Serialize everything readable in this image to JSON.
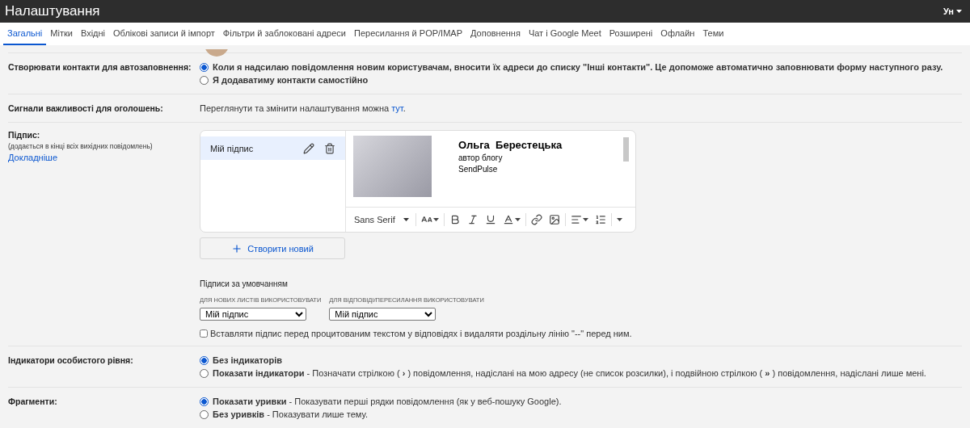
{
  "header": {
    "title": "Налаштування",
    "account": "Ун"
  },
  "tabs": [
    {
      "label": "Загальні",
      "selected": true
    },
    {
      "label": "Мітки",
      "selected": false
    },
    {
      "label": "Вхідні",
      "selected": false
    },
    {
      "label": "Облікові записи й імпорт",
      "selected": false
    },
    {
      "label": "Фільтри й заблоковані адреси",
      "selected": false
    },
    {
      "label": "Пересилання й POP/IMAP",
      "selected": false
    },
    {
      "label": "Доповнення",
      "selected": false
    },
    {
      "label": "Чат і Google Meet",
      "selected": false
    },
    {
      "label": "Розширені",
      "selected": false
    },
    {
      "label": "Офлайн",
      "selected": false
    },
    {
      "label": "Теми",
      "selected": false
    }
  ],
  "settings": [
    {
      "kind": "radio",
      "label": "Створювати контакти для автозаповнення:",
      "options": [
        {
          "title": "Коли я надсилаю повідомлення новим користувачам, вносити їх адреси до списку \"Інші контакти\". Це допоможе автоматично заповнювати форму наступного разу.",
          "selected": true
        },
        {
          "title": "Я додаватиму контакти самостійно",
          "selected": false
        }
      ]
    },
    {
      "kind": "link_text",
      "label": "Сигнали важливості для оголошень:",
      "text_before": "Переглянути та змінити налаштування можна ",
      "link": "тут",
      "text_after": "."
    },
    {
      "kind": "signature",
      "label": "Підпис:",
      "note": "(додається в кінці всіх вихідних повідомлень)",
      "link": "Докладніше",
      "signatures": [
        {
          "name": "Мій підпис",
          "selected": true
        }
      ],
      "preview": {
        "name": "Ольга  Берестецька",
        "lines": [
          "автор блогу",
          "SendPulse"
        ]
      },
      "font": "Sans Serif",
      "create_button": "Створити новий",
      "defaults": {
        "heading": "Підписи за умовчанням",
        "new_label": "ДЛЯ НОВИХ ЛИСТІВ ВИКОРИСТОВУВАТИ",
        "new_value": "Мій підпис",
        "reply_label": "ДЛЯ ВІДПОВІДІ/ПЕРЕСИЛАННЯ ВИКОРИСТОВУВАТИ",
        "reply_value": "Мій підпис"
      },
      "insert_before_quote": {
        "label": "Вставляти підпис перед процитованим текстом у відповідях і видаляти роздільну лінію \"--\" перед ним.",
        "checked": false
      }
    },
    {
      "kind": "radio",
      "label": "Індикатори особистого рівня:",
      "options": [
        {
          "title": "Без індикаторів",
          "selected": true
        },
        {
          "title": "Показати індикатори",
          "description": " - Позначати стрілкою ( **›** ) повідомлення, надіслані на мою адресу (не список розсилки), і подвійною стрілкою ( **»** ) повідомлення, надіслані лише мені.",
          "selected": false
        }
      ]
    },
    {
      "kind": "radio",
      "label": "Фрагменти:",
      "options": [
        {
          "title": "Показати уривки",
          "description": " - Показувати перші рядки повідомлення (як у веб-пошуку Google).",
          "selected": true
        },
        {
          "title": "Без уривків",
          "description": " - Показувати лише тему.",
          "selected": false
        }
      ]
    }
  ]
}
